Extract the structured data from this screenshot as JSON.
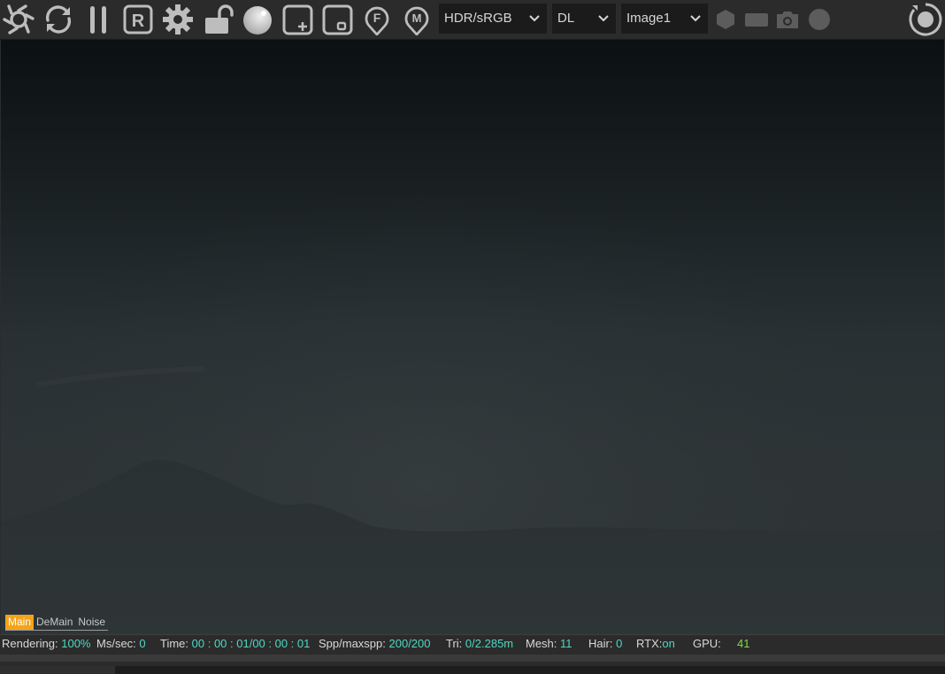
{
  "toolbar": {
    "icons": {
      "render": "aperture-icon",
      "restart": "refresh-icon",
      "pause": "pause-icon",
      "region": "r-icon",
      "settings": "gear-icon",
      "lock": "unlock-icon",
      "material_ball": "sphere-icon",
      "add_region": "add-region-icon",
      "focus": "focus-region-icon",
      "pick_focus": "f-pin-icon",
      "pick_material": "m-pin-icon",
      "hex": "hexagon-icon",
      "rect": "rectangle-icon",
      "camera": "camera-icon",
      "circle": "circle-icon",
      "target": "target-icon"
    },
    "color_space": "HDR/sRGB",
    "kernel": "DL",
    "image": "Image1"
  },
  "render_tabs": [
    "Main",
    "DeMain",
    "Noise"
  ],
  "status": {
    "rendering_label": "Rendering:",
    "rendering_value": "100%",
    "mssec_label": "Ms/sec:",
    "mssec_value": "0",
    "time_label": "Time:",
    "time_value": "00 : 00 : 01/00 : 00 : 01",
    "spp_label": "Spp/maxspp:",
    "spp_value": "200/200",
    "tri_label": "Tri:",
    "tri_value": "0/2.285m",
    "mesh_label": "Mesh:",
    "mesh_value": "11",
    "hair_label": "Hair:",
    "hair_value": "0",
    "rtx_label": "RTX:",
    "rtx_value": "on",
    "gpu_label": "GPU:",
    "gpu_value": "41"
  },
  "colors": {
    "accent_tab": "#f3a31b",
    "status_value": "#4fd7c1",
    "gpu_value": "#7fdc49",
    "toolbar_bg": "#2b2b2b"
  }
}
